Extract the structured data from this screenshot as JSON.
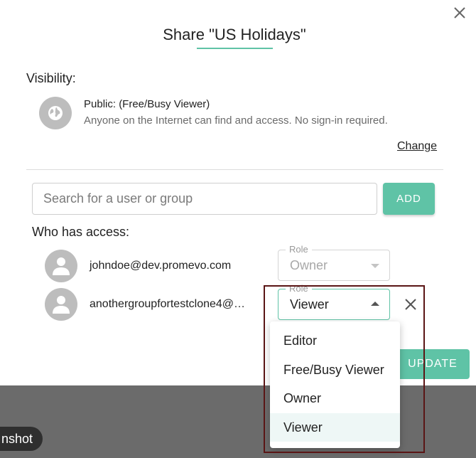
{
  "background": {
    "screenshot_label": "nshot"
  },
  "dialog": {
    "title": "Share \"US Holidays\"",
    "visibility": {
      "label": "Visibility:",
      "title": "Public: (Free/Busy Viewer)",
      "description": "Anyone on the Internet can find and access. No sign-in required.",
      "change_label": "Change"
    },
    "search": {
      "placeholder": "Search for a user or group",
      "value": ""
    },
    "add_label": "ADD",
    "access": {
      "label": "Who has access:",
      "users": [
        {
          "email": "johndoe@dev.promevo.com",
          "role_label": "Role",
          "role": "Owner",
          "editable": false
        },
        {
          "email": "anothergroupfortestclone4@…",
          "role_label": "Role",
          "role": "Viewer",
          "editable": true
        }
      ]
    },
    "update_label": "UPDATE",
    "role_dropdown": {
      "options": [
        "Editor",
        "Free/Busy Viewer",
        "Owner",
        "Viewer"
      ],
      "selected": "Viewer"
    }
  },
  "icons": {
    "close": "close-icon",
    "globe": "globe-icon",
    "avatar": "person-icon",
    "remove": "close-icon",
    "dropdown_arrow": "caret-icon"
  },
  "colors": {
    "accent": "#5fc3a6",
    "icon_bg": "#bdbdbd",
    "selected_bg": "#eef7f6",
    "highlight": "#5a1515"
  }
}
